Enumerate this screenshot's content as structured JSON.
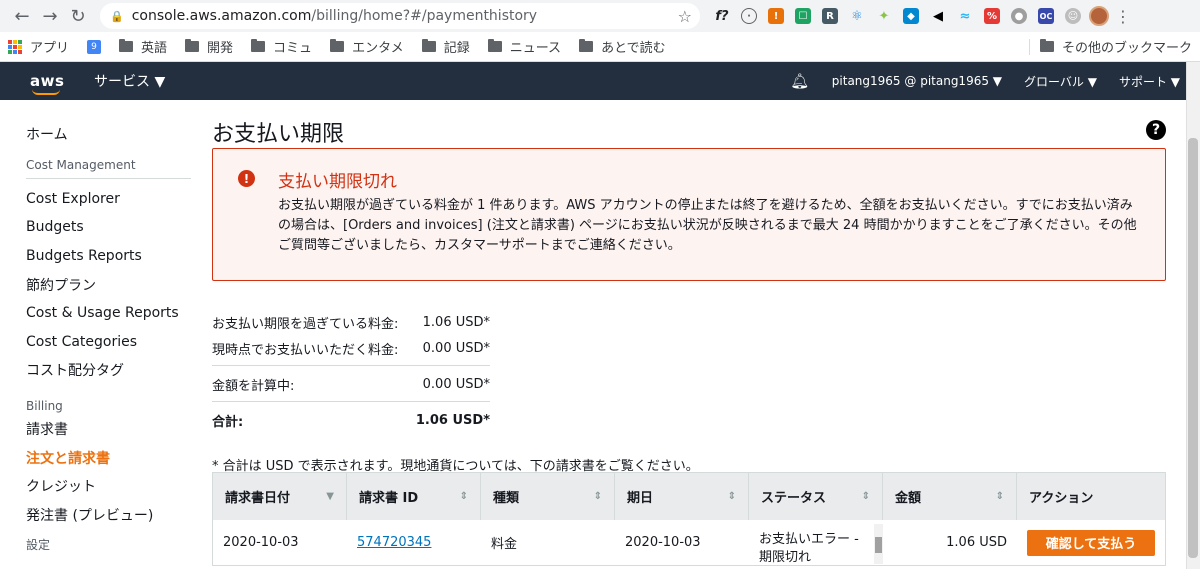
{
  "browser": {
    "url_host": "console.aws.amazon.com",
    "url_path": "/billing/home?#/paymenthistory"
  },
  "bookmarks": {
    "apps_label": "アプリ",
    "calendar_badge": "9",
    "folders": [
      "英語",
      "開発",
      "コミュ",
      "エンタメ",
      "記録",
      "ニュース",
      "あとで読む"
    ],
    "other_label": "その他のブックマーク"
  },
  "awsnav": {
    "logo_text": "aws",
    "services_label": "サービス ▼",
    "account_label": "pitang1965 @ pitang1965 ▼",
    "region_label": "グローバル ▼",
    "support_label": "サポート ▼"
  },
  "sidebar": {
    "home": "ホーム",
    "section_cost": "Cost Management",
    "cost_items": [
      "Cost Explorer",
      "Budgets",
      "Budgets Reports",
      "節約プラン",
      "Cost & Usage Reports",
      "Cost Categories",
      "コスト配分タグ"
    ],
    "section_billing": "Billing",
    "billing_items": [
      "請求書",
      "注文と請求書",
      "クレジット",
      "発注書 (プレビュー)"
    ],
    "section_settings": "設定"
  },
  "main": {
    "title": "お支払い期限",
    "help_glyph": "?",
    "alert": {
      "title": "支払い期限切れ",
      "body": "お支払い期限が過ぎている料金が 1 件あります。AWS アカウントの停止または終了を避けるため、全額をお支払いください。すでにお支払い済みの場合は、[Orders and invoices] (注文と請求書) ページにお支払い状況が反映されるまで最大 24 時間かかりますことをご了承ください。その他ご質問等ございましたら、カスタマーサポートまでご連絡ください。"
    },
    "summary": {
      "overdue_label": "お支払い期限を過ぎている料金:",
      "overdue_value": "1.06 USD*",
      "due_now_label": "現時点でお支払いいただく料金:",
      "due_now_value": "0.00 USD*",
      "calculating_label": "金額を計算中:",
      "calculating_value": "0.00 USD*",
      "total_label": "合計:",
      "total_value": "1.06 USD*"
    },
    "note": "* 合計は USD で表示されます。現地通貨については、下の請求書をご覧ください。"
  },
  "table": {
    "headers": [
      "請求書日付",
      "請求書 ID",
      "種類",
      "期日",
      "ステータス",
      "金額",
      "アクション"
    ],
    "row": {
      "date": "2020-10-03",
      "invoice_id": "574720345",
      "type": "料金",
      "due_date": "2020-10-03",
      "status": "お支払いエラー - 期限切れ",
      "amount": "1.06 USD",
      "action": "確認して支払う"
    }
  }
}
